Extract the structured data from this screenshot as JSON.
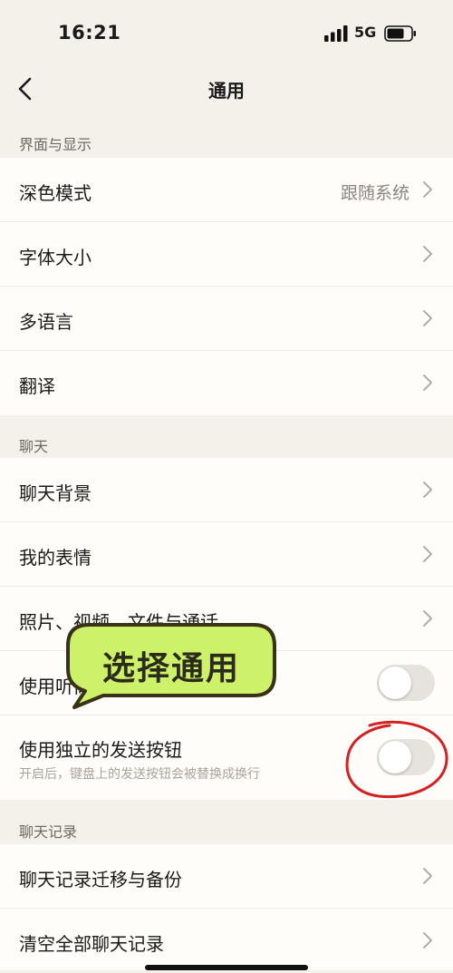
{
  "status_bar": {
    "time": "16:21",
    "network": "5G"
  },
  "nav": {
    "title": "通用"
  },
  "sections": [
    {
      "header": "界面与显示"
    },
    {
      "header": "聊天"
    },
    {
      "header": "聊天记录"
    }
  ],
  "display_items": [
    {
      "label": "深色模式",
      "value": "跟随系统"
    },
    {
      "label": "字体大小"
    },
    {
      "label": "多语言"
    },
    {
      "label": "翻译"
    }
  ],
  "chat_items": [
    {
      "label": "聊天背景"
    },
    {
      "label": "我的表情"
    },
    {
      "label": "照片、视频、文件与通话"
    },
    {
      "label": "使用听筒播放语音",
      "toggle_on": false
    },
    {
      "label": "使用独立的发送按钮",
      "subtitle": "开启后，键盘上的发送按钮会被替换成换行",
      "toggle_on": false
    }
  ],
  "history_items": [
    {
      "label": "聊天记录迁移与备份"
    },
    {
      "label": "清空全部聊天记录"
    }
  ],
  "annotation": {
    "callout_text": "选择通用",
    "callout_color": "#cdf26a",
    "circle_color": "#d42020"
  },
  "icons": {
    "back": "chevron-left-icon",
    "row_arrow": "chevron-right-icon",
    "signal": "signal-icon",
    "battery": "battery-icon"
  }
}
